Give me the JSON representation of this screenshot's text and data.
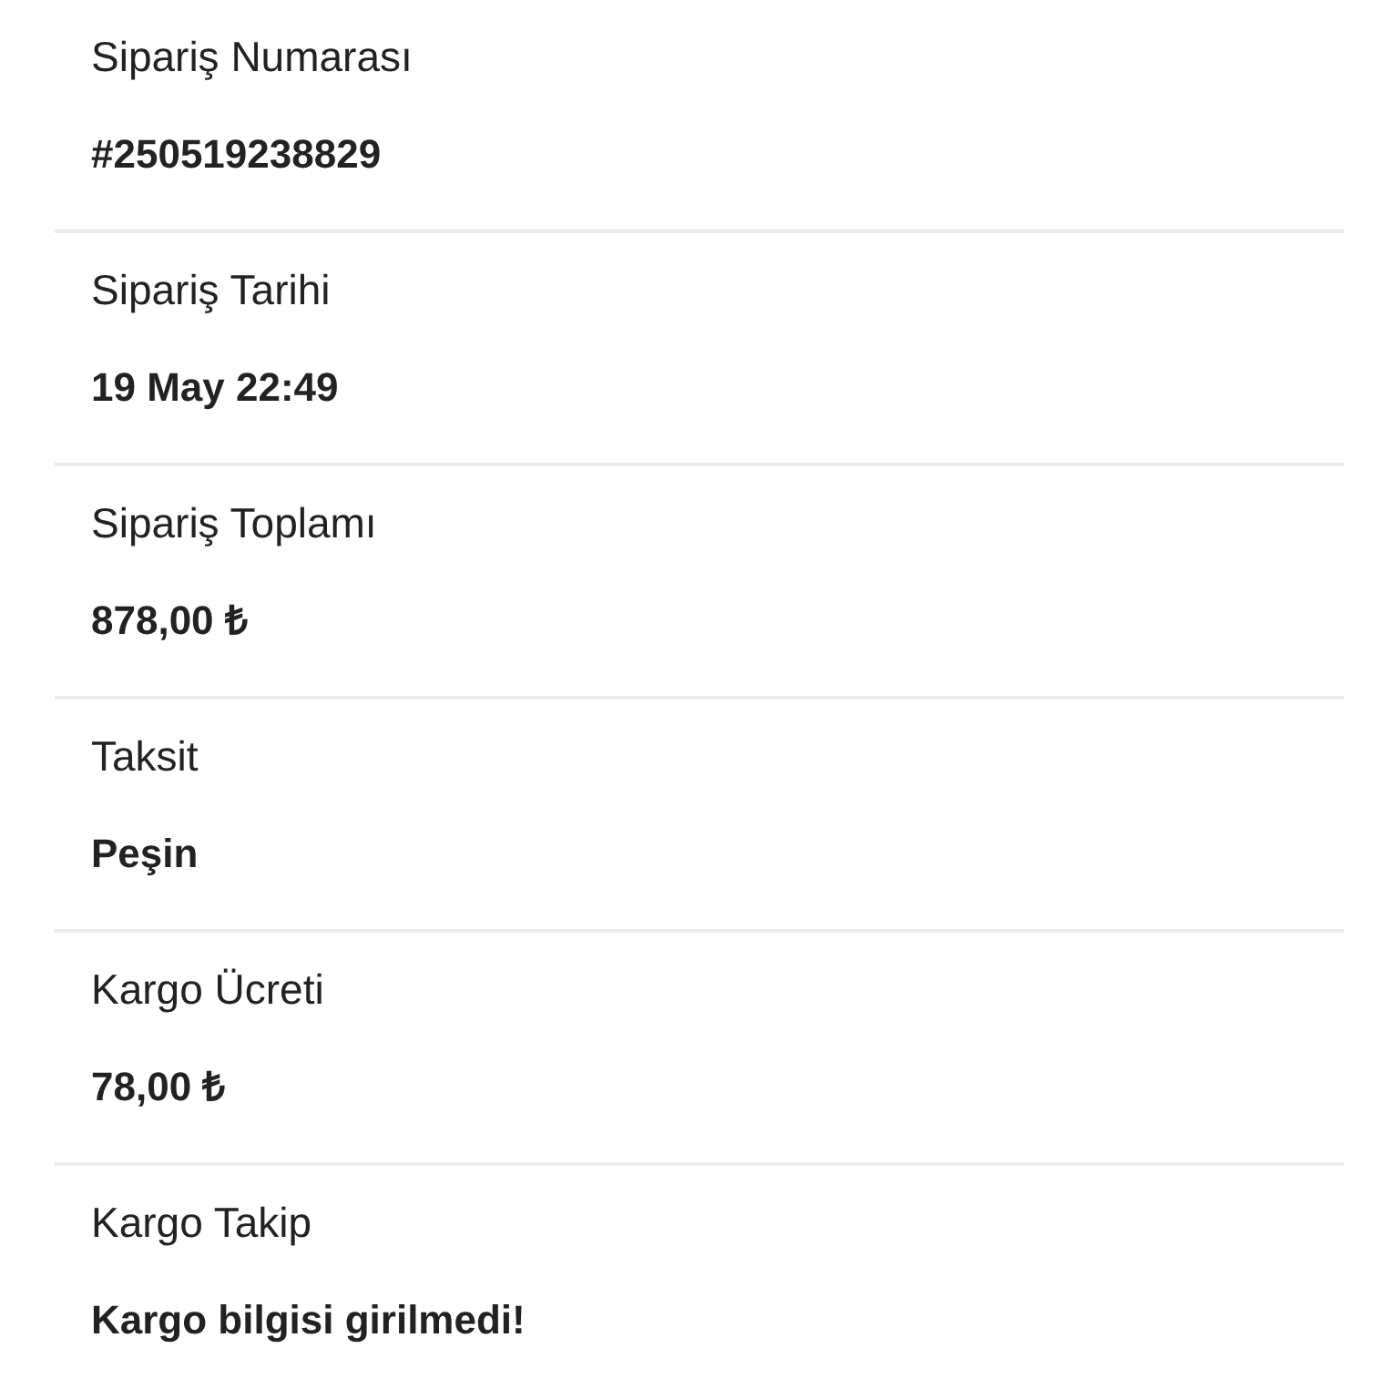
{
  "order_details": [
    {
      "label": "Sipariş Numarası",
      "value": "#250519238829"
    },
    {
      "label": "Sipariş Tarihi",
      "value": "19 May 22:49"
    },
    {
      "label": "Sipariş Toplamı",
      "value": "878,00 ₺"
    },
    {
      "label": "Taksit",
      "value": "Peşin"
    },
    {
      "label": "Kargo Ücreti",
      "value": "78,00 ₺"
    },
    {
      "label": "Kargo Takip",
      "value": "Kargo bilgisi girilmedi!"
    }
  ]
}
